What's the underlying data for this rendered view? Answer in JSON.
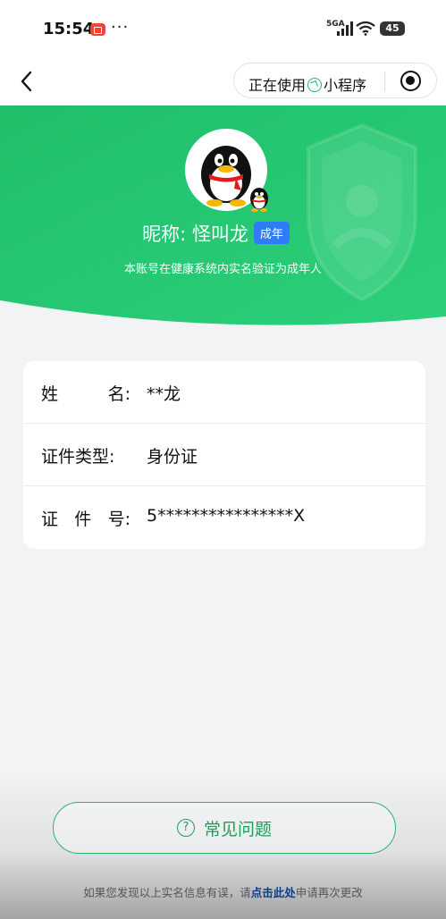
{
  "status_bar": {
    "time": "15:54",
    "more": "···",
    "network": "5GA",
    "battery": "45"
  },
  "nav": {
    "capsule_prefix": "正在使用",
    "capsule_suffix": "小程序"
  },
  "profile": {
    "nickname": "昵称: 怪叫龙",
    "badge": "成年",
    "verify_note": "本账号在健康系统内实名验证为成年人"
  },
  "info": {
    "rows": [
      {
        "label_chars": [
          "姓",
          "名:"
        ],
        "value": "**龙"
      },
      {
        "label_chars": [
          "证件类型:"
        ],
        "value": "身份证"
      },
      {
        "label_chars": [
          "证",
          "件",
          "号:"
        ],
        "value": "5****************X"
      }
    ]
  },
  "faq": {
    "label": "常见问题",
    "icon_text": "?"
  },
  "footer": {
    "prefix": "如果您发现以上实名信息有误，请",
    "link": "点击此处",
    "suffix": "申请再次更改"
  },
  "colors": {
    "header_green": "#22c46e",
    "badge_blue": "#2f7df6",
    "faq_green": "#1f9d5c",
    "link_blue": "#0d3d8c"
  }
}
